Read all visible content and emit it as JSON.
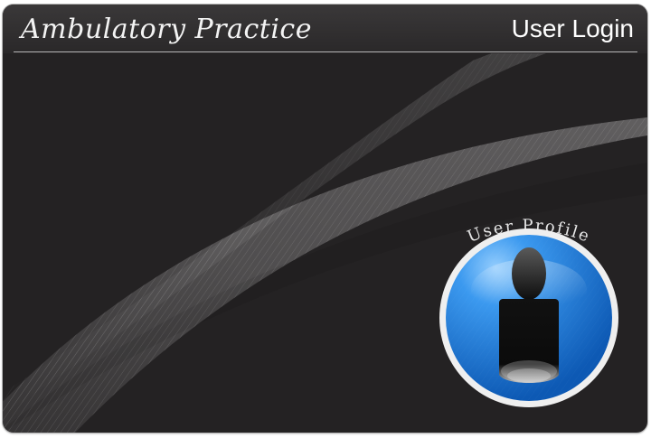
{
  "app": {
    "title": "Ambulatory Practice",
    "page_title": "User Login"
  },
  "profile": {
    "label": "User Profile",
    "icon": "user-profile-icon"
  },
  "colors": {
    "panel_background": "#242223",
    "accent_blue": "#1f78d9",
    "text": "#f3f3f3"
  }
}
